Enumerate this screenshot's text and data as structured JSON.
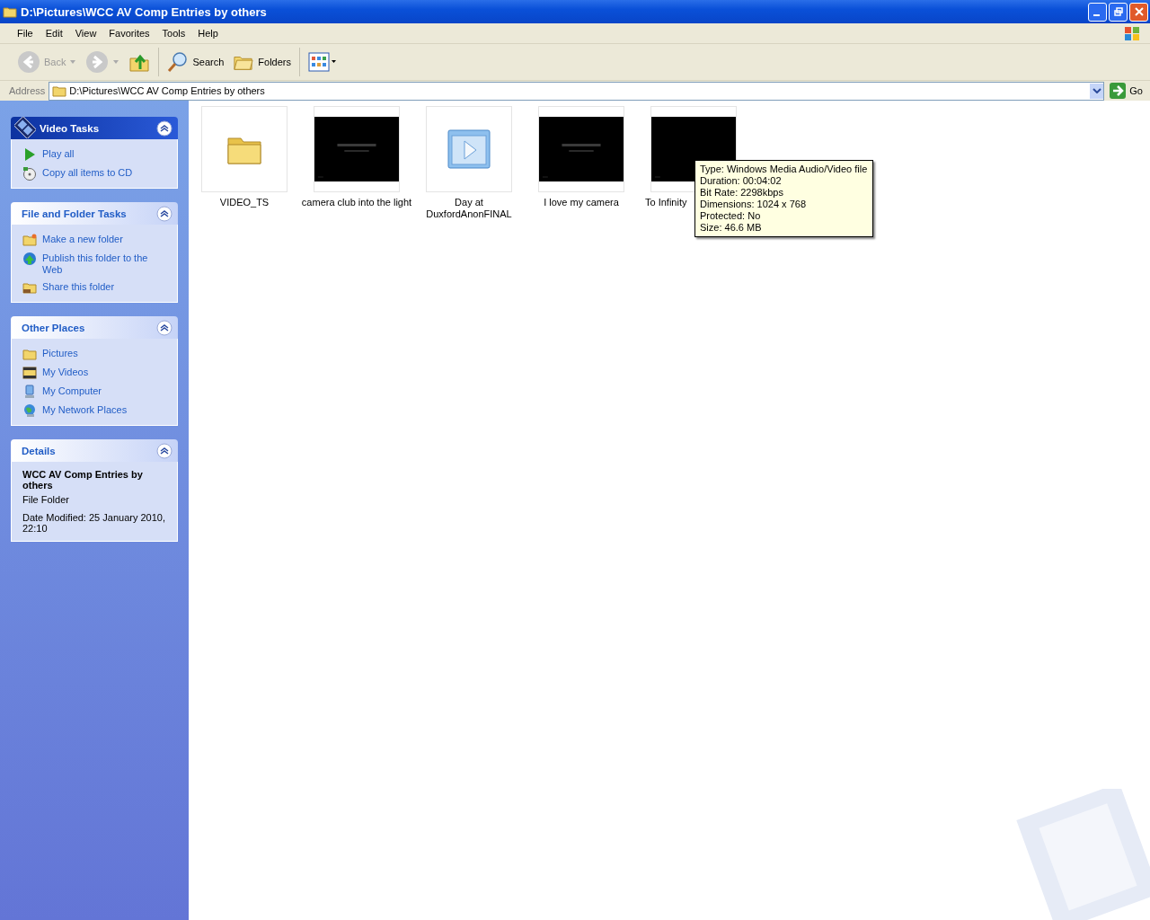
{
  "window": {
    "title": "D:\\Pictures\\WCC AV Comp Entries by others"
  },
  "menu": [
    "File",
    "Edit",
    "View",
    "Favorites",
    "Tools",
    "Help"
  ],
  "toolbar": [
    {
      "kind": "back",
      "label": "Back",
      "disabled": true
    },
    {
      "kind": "forward",
      "disabled": true
    },
    {
      "kind": "up"
    },
    {
      "kind": "search",
      "label": "Search"
    },
    {
      "kind": "folders",
      "label": "Folders"
    },
    {
      "kind": "views"
    }
  ],
  "address": {
    "label": "Address",
    "value": "D:\\Pictures\\WCC AV Comp Entries by others",
    "go": "Go"
  },
  "sidebar": {
    "panels": [
      {
        "kind": "special",
        "title": "Video Tasks",
        "items": [
          {
            "kind": "play",
            "label": "Play all"
          },
          {
            "kind": "cd",
            "label": "Copy all items to CD"
          }
        ]
      },
      {
        "kind": "tasks",
        "title": "File and Folder Tasks",
        "items": [
          {
            "kind": "newfolder",
            "label": "Make a new folder"
          },
          {
            "kind": "globe",
            "label": "Publish this folder to the Web"
          },
          {
            "kind": "share",
            "label": "Share this folder"
          }
        ]
      },
      {
        "kind": "tasks",
        "title": "Other Places",
        "items": [
          {
            "kind": "folder",
            "label": "Pictures"
          },
          {
            "kind": "videos",
            "label": "My Videos"
          },
          {
            "kind": "computer",
            "label": "My Computer"
          },
          {
            "kind": "network",
            "label": "My Network Places"
          }
        ]
      },
      {
        "kind": "details",
        "title": "Details",
        "name": "WCC AV Comp Entries by others",
        "type": "File Folder",
        "modified": "Date Modified: 25 January 2010, 22:10"
      }
    ]
  },
  "files": [
    {
      "kind": "folder",
      "name": "VIDEO_TS"
    },
    {
      "kind": "thumbnail",
      "name": "camera club into the light"
    },
    {
      "kind": "video",
      "name": "Day at DuxfordAnonFINAL"
    },
    {
      "kind": "thumbnail",
      "name": "I love my camera"
    },
    {
      "kind": "thumbnail",
      "name": "To Infinity"
    }
  ],
  "tooltip": [
    "Type: Windows Media Audio/Video file",
    "Duration: 00:04:02",
    "Bit Rate: 2298kbps",
    "Dimensions: 1024 x 768",
    "Protected: No",
    "Size: 46.6 MB"
  ]
}
